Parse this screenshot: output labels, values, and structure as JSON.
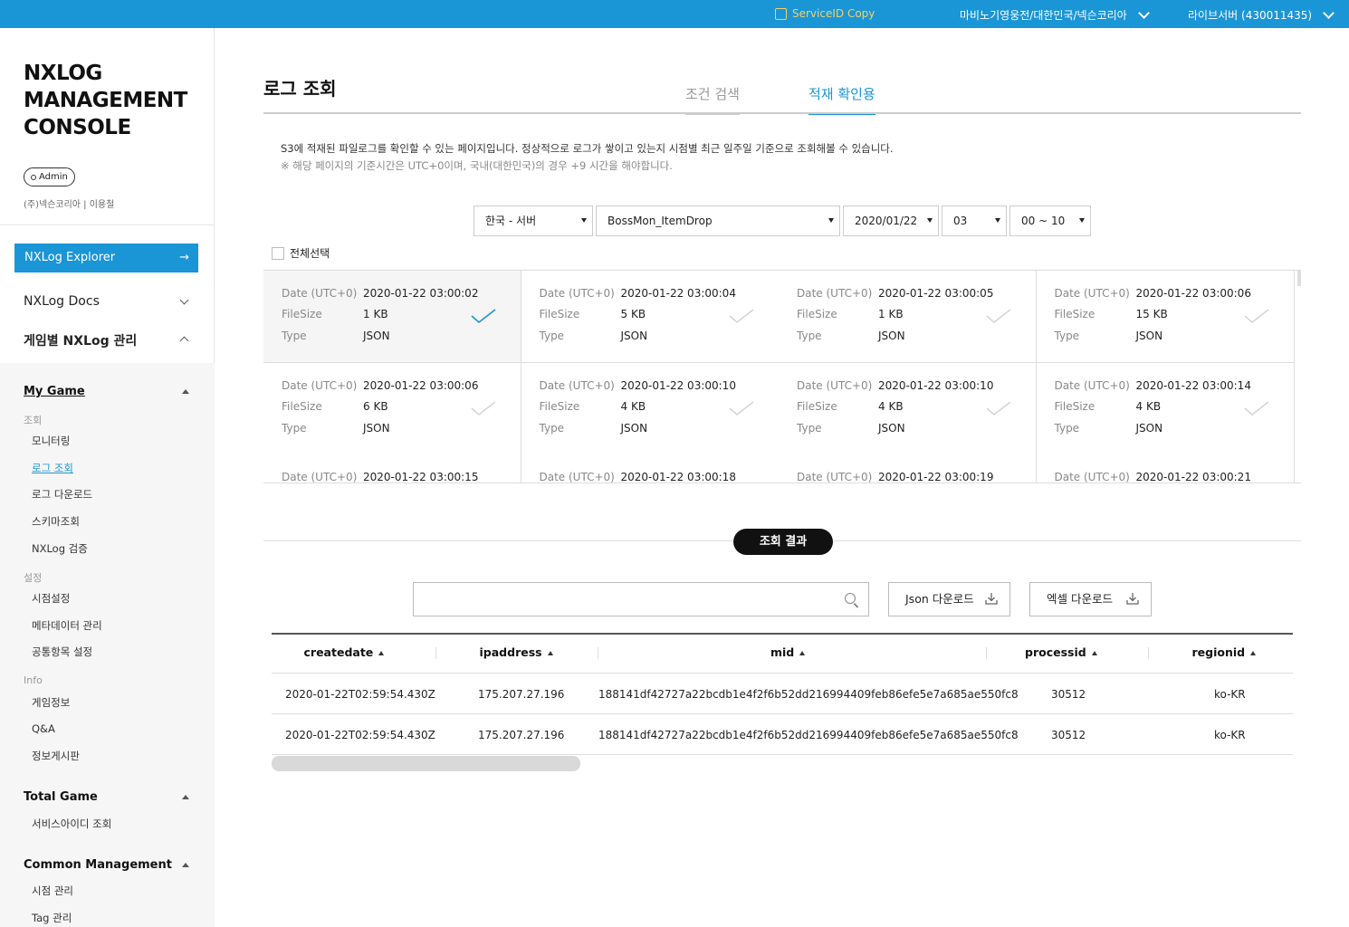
{
  "topbar": {
    "service_copy": "ServiceID Copy",
    "game_select": "마비노기영웅전/대한민국/넥슨코리아",
    "server_select": "라이브서버 (430011435)"
  },
  "sidebar": {
    "brand_line1": "NXLOG",
    "brand_line2": "MANAGEMENT",
    "brand_line3": "CONSOLE",
    "role": "Admin",
    "user": "(주)넥슨코리아 | 이용철",
    "explorer": "NXLog Explorer",
    "explorer_arrow": "→",
    "docs": "NXLog Docs",
    "game_mgmt": "게임별 NXLog 관리",
    "my_game": "My Game",
    "sec_query": "조회",
    "monitoring": "모니터링",
    "log_query": "로그 조회",
    "log_download": "로그 다운로드",
    "schema": "스키마조회",
    "nxlog_verify": "NXLog 검증",
    "sec_settings": "설정",
    "point_settings": "시점설정",
    "metadata": "메타데이터 관리",
    "common_items": "공통항목 설정",
    "sec_info": "Info",
    "game_info": "게임정보",
    "qa": "Q&A",
    "board": "정보게시판",
    "total_game": "Total Game",
    "service_id": "서비스아이디 조회",
    "common_mgmt": "Common Management",
    "point_mgmt": "시점 관리",
    "tag_mgmt": "Tag 관리"
  },
  "main": {
    "title": "로그 조회",
    "tab_search": "조건 검색",
    "tab_check": "적재 확인용",
    "desc1": "S3에 적재된 파일로그를 확인할 수 있는 페이지입니다. 정상적으로 로그가 쌓이고 있는지 시점별 최근 일주일 기준으로 조회해볼 수 있습니다.",
    "desc2": "※ 해당 페이지의 기준시간은 UTC+0이며, 국내(대한민국)의 경우 +9 시간을 해야합니다.",
    "filters": {
      "region": "한국 - 서버",
      "log": "BossMon_ItemDrop",
      "date": "2020/01/22",
      "hour": "03",
      "minute": "00 ~ 10"
    },
    "select_all": "전체선택",
    "card_keys": {
      "date": "Date (UTC+0)",
      "size": "FileSize",
      "type": "Type"
    },
    "cards": [
      {
        "date": "2020-01-22 03:00:02",
        "size": "1 KB",
        "type": "JSON",
        "selected": true
      },
      {
        "date": "2020-01-22 03:00:04",
        "size": "5 KB",
        "type": "JSON",
        "selected": false
      },
      {
        "date": "2020-01-22 03:00:05",
        "size": "1 KB",
        "type": "JSON",
        "selected": false
      },
      {
        "date": "2020-01-22 03:00:06",
        "size": "15 KB",
        "type": "JSON",
        "selected": false
      },
      {
        "date": "2020-01-22 03:00:06",
        "size": "6 KB",
        "type": "JSON",
        "selected": false
      },
      {
        "date": "2020-01-22 03:00:10",
        "size": "4 KB",
        "type": "JSON",
        "selected": false
      },
      {
        "date": "2020-01-22 03:00:10",
        "size": "4 KB",
        "type": "JSON",
        "selected": false
      },
      {
        "date": "2020-01-22 03:00:14",
        "size": "4 KB",
        "type": "JSON",
        "selected": false
      },
      {
        "date": "2020-01-22 03:00:15",
        "size": "",
        "type": "",
        "selected": false
      },
      {
        "date": "2020-01-22 03:00:18",
        "size": "",
        "type": "",
        "selected": false
      },
      {
        "date": "2020-01-22 03:00:19",
        "size": "",
        "type": "",
        "selected": false
      },
      {
        "date": "2020-01-22 03:00:21",
        "size": "",
        "type": "",
        "selected": false
      }
    ],
    "result_label": "조회 결과",
    "search_value": "",
    "json_download": "Json 다운로드",
    "excel_download": "엑셀 다운로드",
    "columns": [
      "createdate",
      "ipaddress",
      "mid",
      "processid",
      "regionid"
    ],
    "rows": [
      [
        "2020-01-22T02:59:54.430Z",
        "175.207.27.196",
        "188141df42727a22bcdb1e4f2f6b52dd216994409feb86efe5e7a685ae550fc8",
        "30512",
        "ko-KR"
      ],
      [
        "2020-01-22T02:59:54.430Z",
        "175.207.27.196",
        "188141df42727a22bcdb1e4f2f6b52dd216994409feb86efe5e7a685ae550fc8",
        "30512",
        "ko-KR"
      ]
    ]
  },
  "colors": {
    "accent": "#1a95d6",
    "copy": "#f0d36b"
  }
}
